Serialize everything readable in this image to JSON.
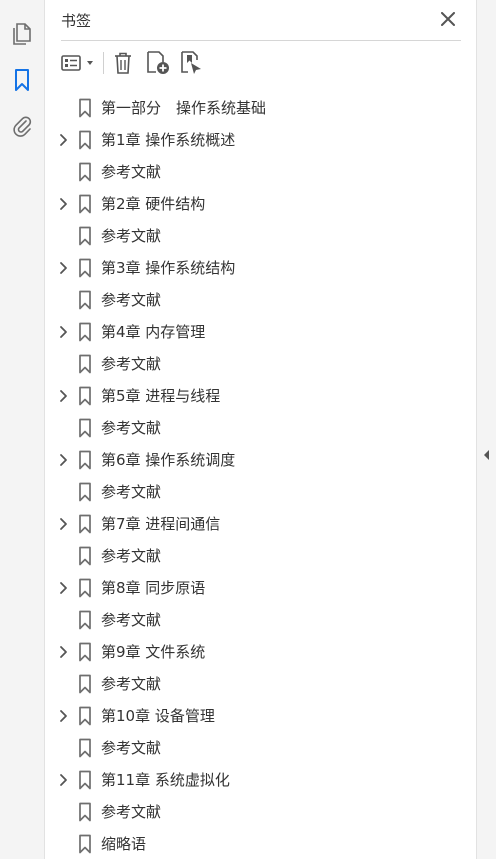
{
  "panel": {
    "title": "书签"
  },
  "left_toolbar": [
    {
      "name": "pages-icon"
    },
    {
      "name": "bookmarks-icon",
      "active": true
    },
    {
      "name": "attachments-icon"
    }
  ],
  "colors": {
    "accent": "#1473e6",
    "icon": "#6e6e6e",
    "text": "#333333"
  },
  "bookmarks": [
    {
      "label": "第一部分　操作系统基础",
      "expandable": false
    },
    {
      "label": "第1章 操作系统概述",
      "expandable": true
    },
    {
      "label": "参考文献",
      "expandable": false
    },
    {
      "label": "第2章 硬件结构",
      "expandable": true
    },
    {
      "label": "参考文献",
      "expandable": false
    },
    {
      "label": "第3章 操作系统结构",
      "expandable": true
    },
    {
      "label": "参考文献",
      "expandable": false
    },
    {
      "label": "第4章 内存管理",
      "expandable": true
    },
    {
      "label": "参考文献",
      "expandable": false
    },
    {
      "label": "第5章 进程与线程",
      "expandable": true
    },
    {
      "label": "参考文献",
      "expandable": false
    },
    {
      "label": "第6章 操作系统调度",
      "expandable": true
    },
    {
      "label": "参考文献",
      "expandable": false
    },
    {
      "label": "第7章 进程间通信",
      "expandable": true
    },
    {
      "label": "参考文献",
      "expandable": false
    },
    {
      "label": "第8章 同步原语",
      "expandable": true
    },
    {
      "label": "参考文献",
      "expandable": false
    },
    {
      "label": "第9章 文件系统",
      "expandable": true
    },
    {
      "label": "参考文献",
      "expandable": false
    },
    {
      "label": "第10章 设备管理",
      "expandable": true
    },
    {
      "label": "参考文献",
      "expandable": false
    },
    {
      "label": "第11章 系统虚拟化",
      "expandable": true
    },
    {
      "label": "参考文献",
      "expandable": false
    },
    {
      "label": "缩略语",
      "expandable": false
    }
  ]
}
